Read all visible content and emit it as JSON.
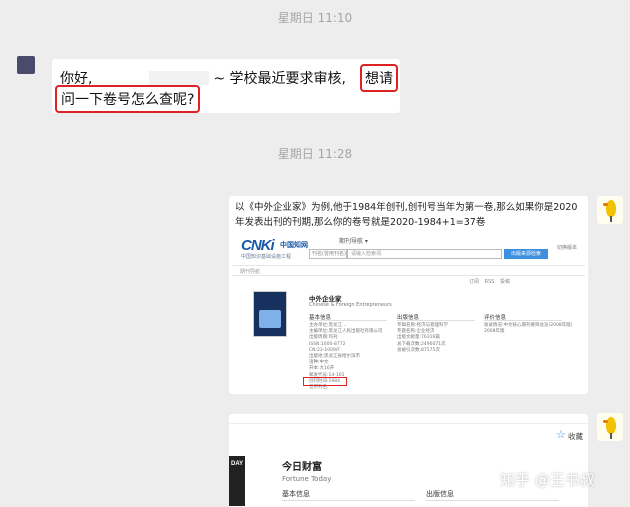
{
  "timestamps": [
    "星期日 11:10",
    "星期日 11:28"
  ],
  "message_in": {
    "text_start": "你好,",
    "text_mid": "~ 学校最近要求审核,",
    "highlight_1": "想请",
    "highlight_2": "问一下卷号怎么查呢?"
  },
  "message_out_image1": {
    "caption": "以《中外企业家》为例,他于1984年创刊,创刊号当年为第一卷,那么如果你是2020年发表出刊的刊期,那么你的卷号就是2020-1984+1=37卷",
    "cnki": {
      "logo_main": "CNKi",
      "logo_cn": "中国知网",
      "logo_sub": "中国知识基础设施工程",
      "nav": "期刊导航 ▾",
      "select_placeholder": "刊名(曾用刊名)",
      "search_placeholder": "请输入检索词",
      "search_button": "出版来源检索",
      "top_right": "切换版本",
      "bar_text": "期刊导航",
      "actions": "订阅 RSS 投稿",
      "journal_title": "中外企业家",
      "journal_sub": "Chinese & Foreign Entrepreneurs",
      "col_headers": [
        "基本信息",
        "出版信息",
        "评价信息"
      ],
      "col1_rows": [
        "主办单位:黑龙江…",
        "主编单位:黑龙江人民出版社有限公司",
        "出版周期:旬刊",
        "ISSN:1000-8772",
        "CN:23-1009/F",
        "出版地:黑龙江省哈尔滨市",
        "语种:中文",
        "开本:大16开",
        "邮发代号:14-165",
        "创刊时间:1984",
        "曾用刊名:"
      ],
      "col2_rows": [
        "专辑名称:经济与管理科学",
        "专题名称:企业经济",
        "出版文献量:76316篇",
        "总下载次数:2496071次",
        "总被引次数:87575次"
      ],
      "col3_rows": [
        "收录情况:中文核心期刊要目总览(2008年版)",
        "2008年版"
      ]
    }
  },
  "message_out_image2": {
    "favorite": "收藏",
    "cover_text": "DAY",
    "journal_title": "今日财富",
    "journal_sub": "Fortune Today",
    "col_headers": [
      "基本信息",
      "出版信息"
    ]
  },
  "watermark": "知乎 @王书叔",
  "colors": {
    "chat_bg": "#ededed",
    "bubble": "#ffffff",
    "highlight_border": "#d22222",
    "link_blue": "#3d8fe0"
  },
  "icons": {
    "left_avatar": "user-avatar",
    "right_avatar": "yellow-bird-avatar",
    "favorite": "star-icon"
  }
}
